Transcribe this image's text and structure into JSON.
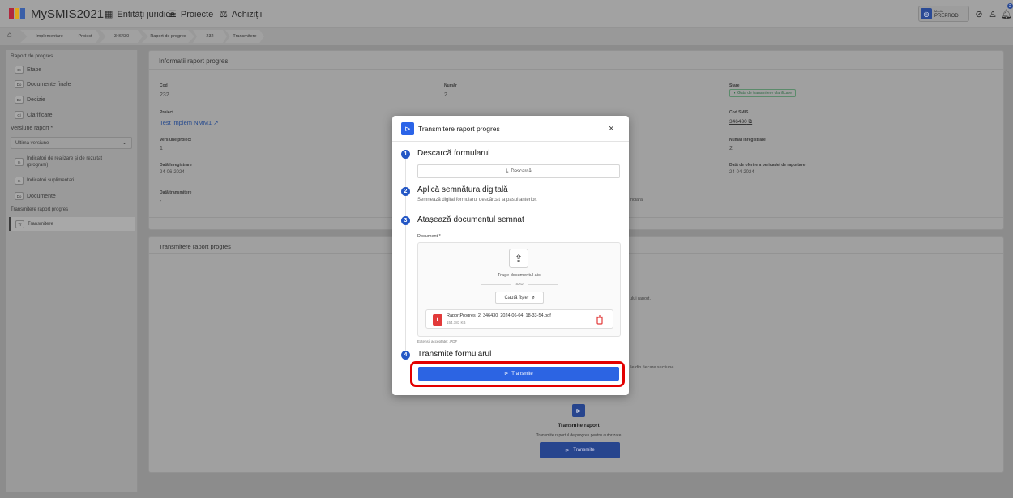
{
  "app": {
    "title": "MySMIS2021"
  },
  "topnav": {
    "entities": "Entități juridice",
    "projects": "Proiecte",
    "procurement": "Achiziții"
  },
  "topright": {
    "env_small": "Mediu",
    "env": "PREPROD",
    "notif_count": "2"
  },
  "breadcrumb": [
    "Implementare",
    "Proiect",
    "346430",
    "Raport de progres",
    "232",
    "Transmitere"
  ],
  "sidebar": {
    "section_title": "Raport de progres",
    "items": [
      {
        "icon": "Et",
        "label": "Etape"
      },
      {
        "icon": "Do",
        "label": "Documente finale"
      },
      {
        "icon": "De",
        "label": "Decizie"
      },
      {
        "icon": "Cl",
        "label": "Clarificare"
      }
    ],
    "version_label": "Versiune raport *",
    "version_value": "Ultima versiune",
    "items2": [
      {
        "icon": "In",
        "label1": "Indicatori de realizare și de rezultat",
        "label2": "(program)"
      },
      {
        "icon": "In",
        "label1": "Indicatori suplimentari",
        "label2": ""
      },
      {
        "icon": "Do",
        "label1": "Documente",
        "label2": ""
      }
    ],
    "submit_section": "Transmitere raport progres",
    "submit_item": {
      "icon": "Tr",
      "label": "Transmitere"
    }
  },
  "info_card": {
    "title": "Informații raport progres",
    "fields": {
      "cod_label": "Cod",
      "cod_value": "232",
      "numar_label": "Număr",
      "numar_value": "2",
      "stare_label": "Stare",
      "stare_value": "Gata de transmitere clarificare",
      "proiect_label": "Proiect",
      "proiect_value": "Test implem NMM1",
      "codsmis_label": "Cod SMIS",
      "codsmis_value": "346430",
      "versiune_label": "Versiune proiect",
      "versiune_value": "1",
      "numarinreg_label": "Număr înregistrare",
      "numarinreg_value": "2",
      "datainreg_label": "Dată înregistrare",
      "datainreg_value": "24-06-2024",
      "dataoferta_label": "Dată de oferire a perioadei de raportare",
      "dataoferta_value": "24-04-2024",
      "datatrans_label": "Dată transmitere",
      "datatrans_value": "-",
      "partial_text": "nciară"
    }
  },
  "submit_card": {
    "title": "Transmitere raport progres",
    "behind_text1": "ului raport.",
    "behind_text2": "ile din fiecare secțiune.",
    "tile_title": "Transmite raport",
    "tile_subtitle": "Transmite raportul de progres pentru autorizare",
    "tile_button": "Transmite"
  },
  "modal": {
    "title": "Transmitere raport progres",
    "step1": {
      "num": "1",
      "title": "Descarcă formularul",
      "button": "Descarcă"
    },
    "step2": {
      "num": "2",
      "title": "Aplică semnătura digitală",
      "desc": "Semnează digital formularul descărcat la pasul anterior."
    },
    "step3": {
      "num": "3",
      "title": "Atașează documentul semnat",
      "doc_label": "Document *",
      "drop_text": "Trage documentul aici",
      "or_text": "SAU",
      "browse_button": "Caută fișier",
      "file_name": "RaportProgres_2_346430_2024-06-04_18-33-54.pdf",
      "file_size": "154.183 KB",
      "accepted": "Extensii acceptate: .PDF"
    },
    "step4": {
      "num": "4",
      "title": "Transmite formularul",
      "button": "Transmite"
    }
  },
  "colors": {
    "primary": "#2c64e3",
    "step": "#2457c5",
    "highlight": "#e30000",
    "pdf": "#e23a3a"
  }
}
